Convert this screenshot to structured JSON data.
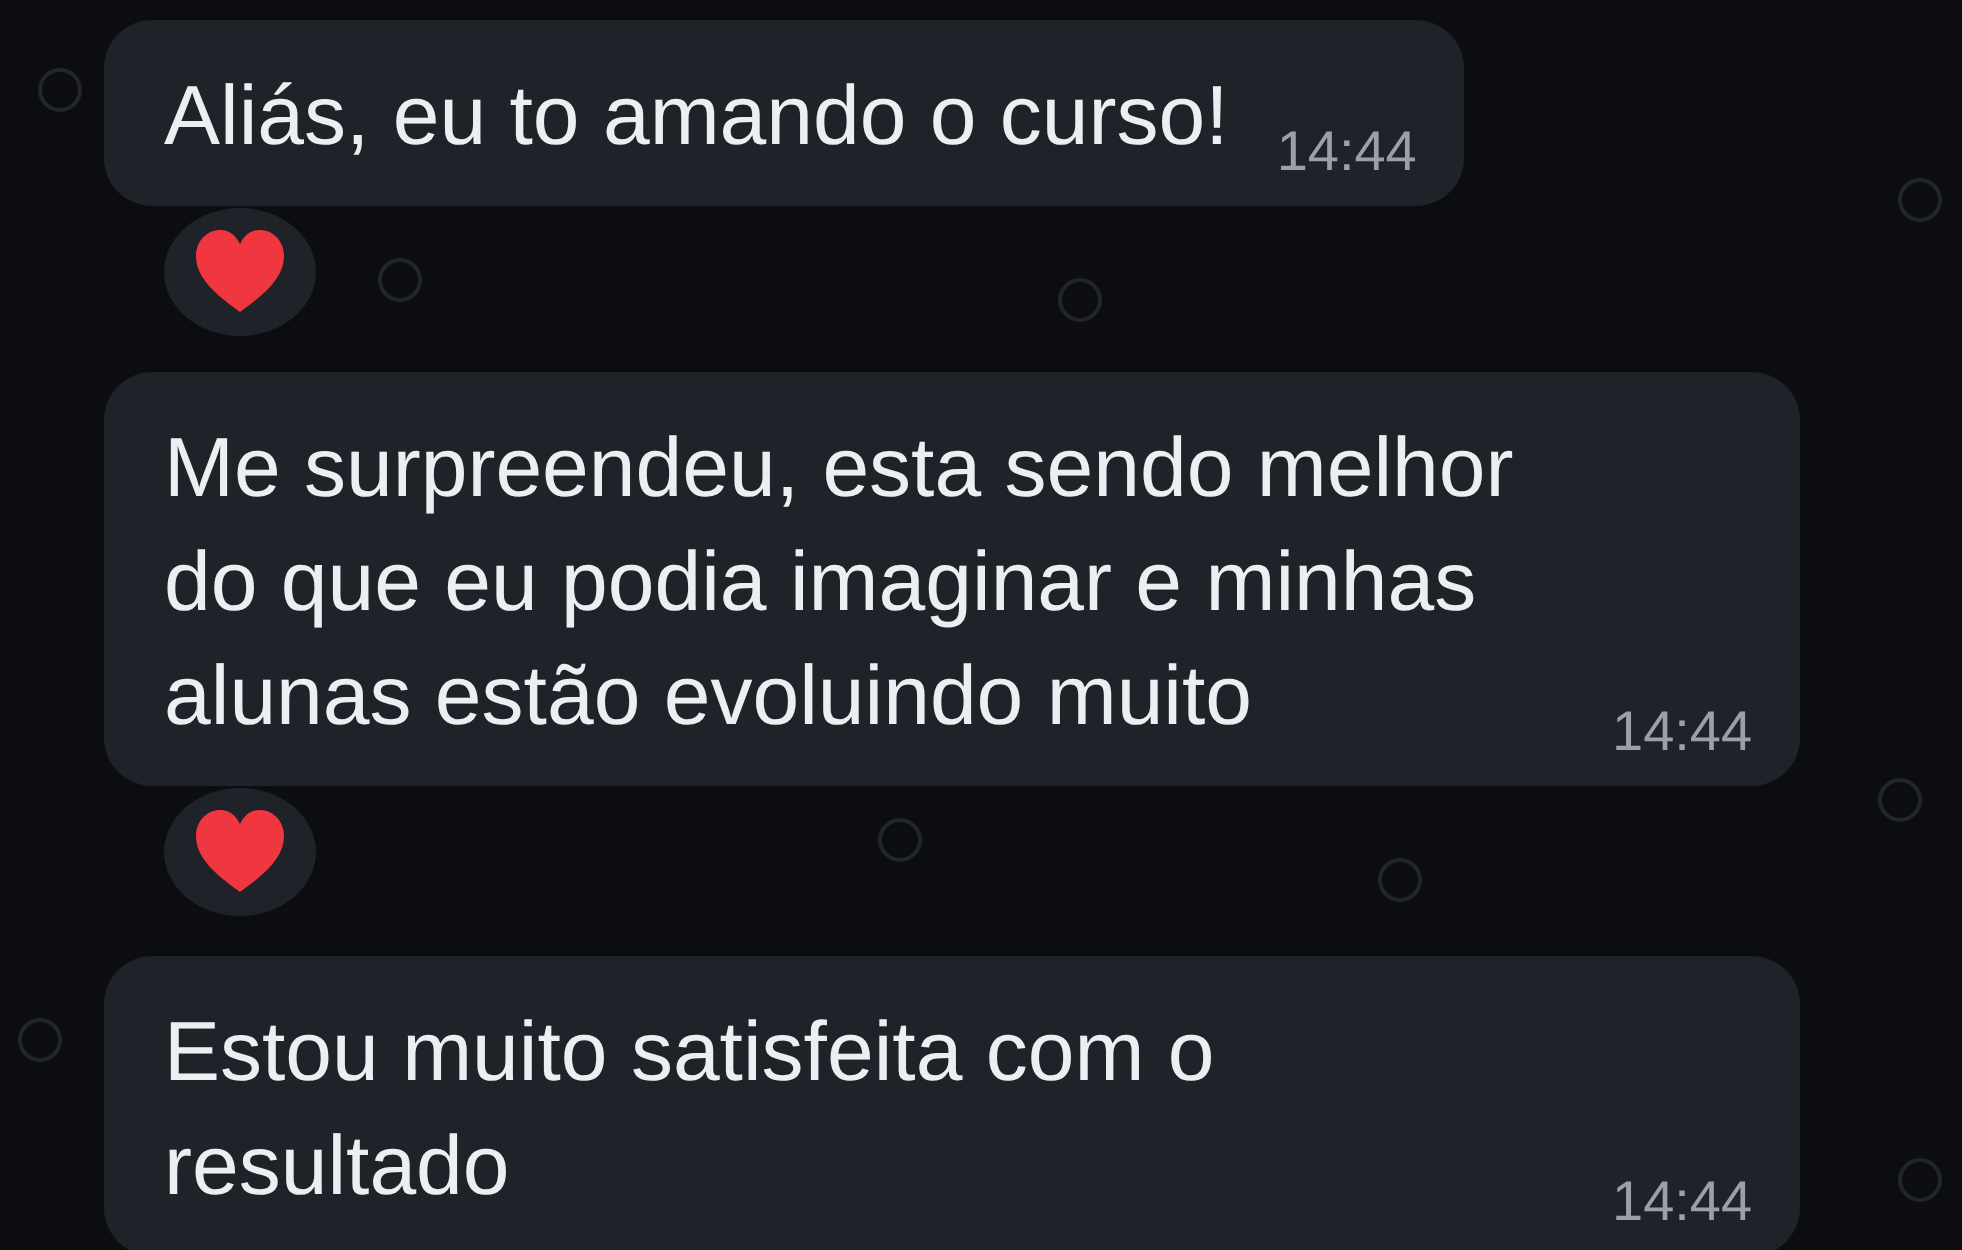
{
  "messages": [
    {
      "text": "Aliás, eu to amando o curso!",
      "time": "14:44",
      "reacted": true
    },
    {
      "text": "Me surpreendeu, esta sendo melhor do que eu podia imaginar e minhas alunas estão evoluindo muito",
      "time": "14:44",
      "reacted": true
    },
    {
      "text": "Estou muito satisfeita com o resultado",
      "time": "14:44",
      "reacted": false
    }
  ]
}
